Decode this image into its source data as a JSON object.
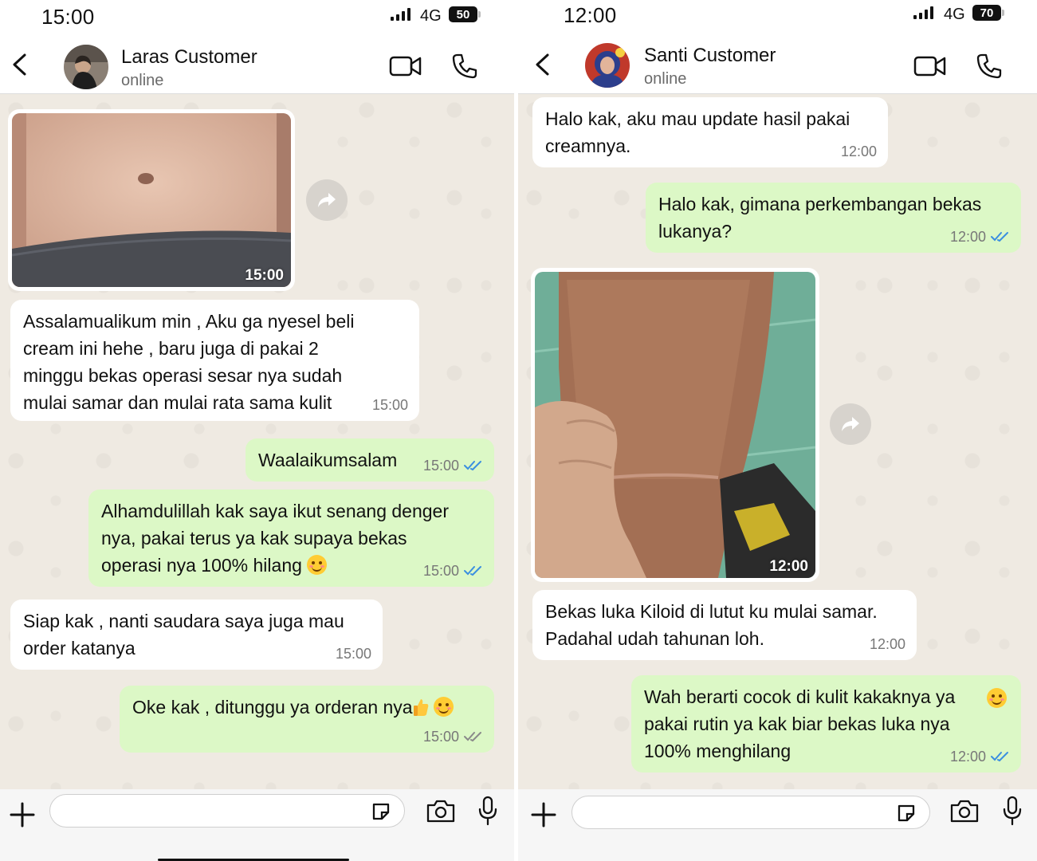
{
  "left": {
    "status": {
      "time": "15:00",
      "network": "4G",
      "battery": "50"
    },
    "header": {
      "name": "Laras Customer",
      "state": "online"
    },
    "messages": {
      "m0_time": "15:00",
      "m1_text": "Assalamualikum min , Aku ga nyesel beli\ncream ini hehe , baru juga di pakai 2\nminggu bekas operasi sesar nya sudah\nmulai samar dan mulai rata sama kulit",
      "m1_time": "15:00",
      "m2_text": "Waalaikumsalam",
      "m2_time": "15:00",
      "m3_text": "Alhamdulillah kak saya ikut senang denger\nnya, pakai terus ya kak supaya bekas\noperasi nya 100% hilang",
      "m3_time": "15:00",
      "m4_text": "Siap kak , nanti saudara saya juga mau\norder katanya",
      "m4_time": "15:00",
      "m5_text": "Oke kak , ditunggu ya orderan nya",
      "m5_time": "15:00"
    }
  },
  "right": {
    "status": {
      "time": "12:00",
      "network": "4G",
      "battery": "70"
    },
    "header": {
      "name": "Santi Customer",
      "state": "online"
    },
    "messages": {
      "m1_text": "Halo kak, aku mau update hasil pakai\ncreamnya.",
      "m1_time": "12:00",
      "m2_text": "Halo kak, gimana perkembangan bekas\nlukanya?",
      "m2_time": "12:00",
      "m3_time": "12:00",
      "m4_text": "Bekas luka Kiloid di lutut ku mulai samar.\nPadahal udah tahunan loh.",
      "m4_time": "12:00",
      "m5_text": "Wah berarti cocok di kulit kakaknya ya\npakai rutin ya kak biar bekas luka nya\n100% menghilang",
      "m5_time": "12:00"
    }
  },
  "colors": {
    "incoming": "#ffffff",
    "outgoing": "#dcf8c6",
    "read_tick": "#3b8fe0",
    "sent_tick": "#8a8a8a",
    "wallpaper": "#efeae2"
  },
  "icons": [
    "back-icon",
    "video-call-icon",
    "phone-icon",
    "forward-icon",
    "plus-icon",
    "sticker-icon",
    "camera-icon",
    "mic-icon",
    "double-tick-icon"
  ]
}
